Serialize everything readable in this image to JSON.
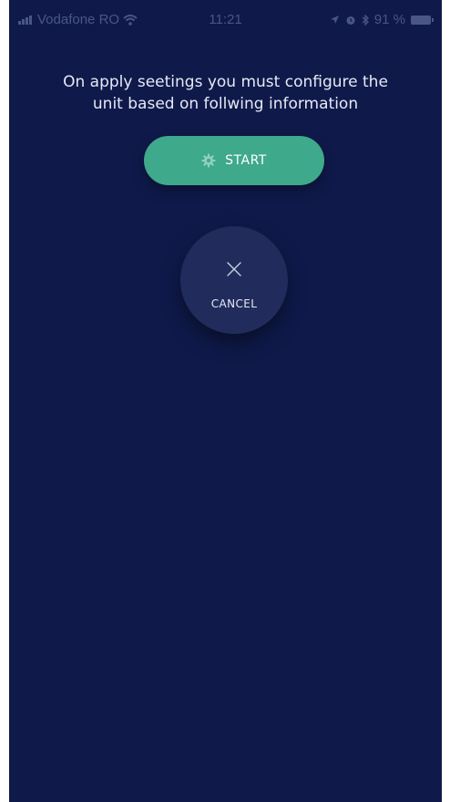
{
  "status_bar": {
    "carrier": "Vodafone RO",
    "time": "11:21",
    "battery_percent": "91 %",
    "icons": [
      "signal-icon",
      "wifi-icon",
      "location-arrow-icon",
      "alarm-icon",
      "bluetooth-icon",
      "battery-icon"
    ]
  },
  "message": {
    "line1": "On apply seetings you must configure the",
    "line2": "unit based on follwing information"
  },
  "start_button": {
    "label": "START",
    "icon": "gear-icon",
    "color": "#3fa98b"
  },
  "cancel_button": {
    "label": "CANCEL",
    "icon": "close-icon",
    "color": "#212c5c"
  },
  "colors": {
    "background": "#0f1a4b",
    "text": "#e6e9f4"
  }
}
